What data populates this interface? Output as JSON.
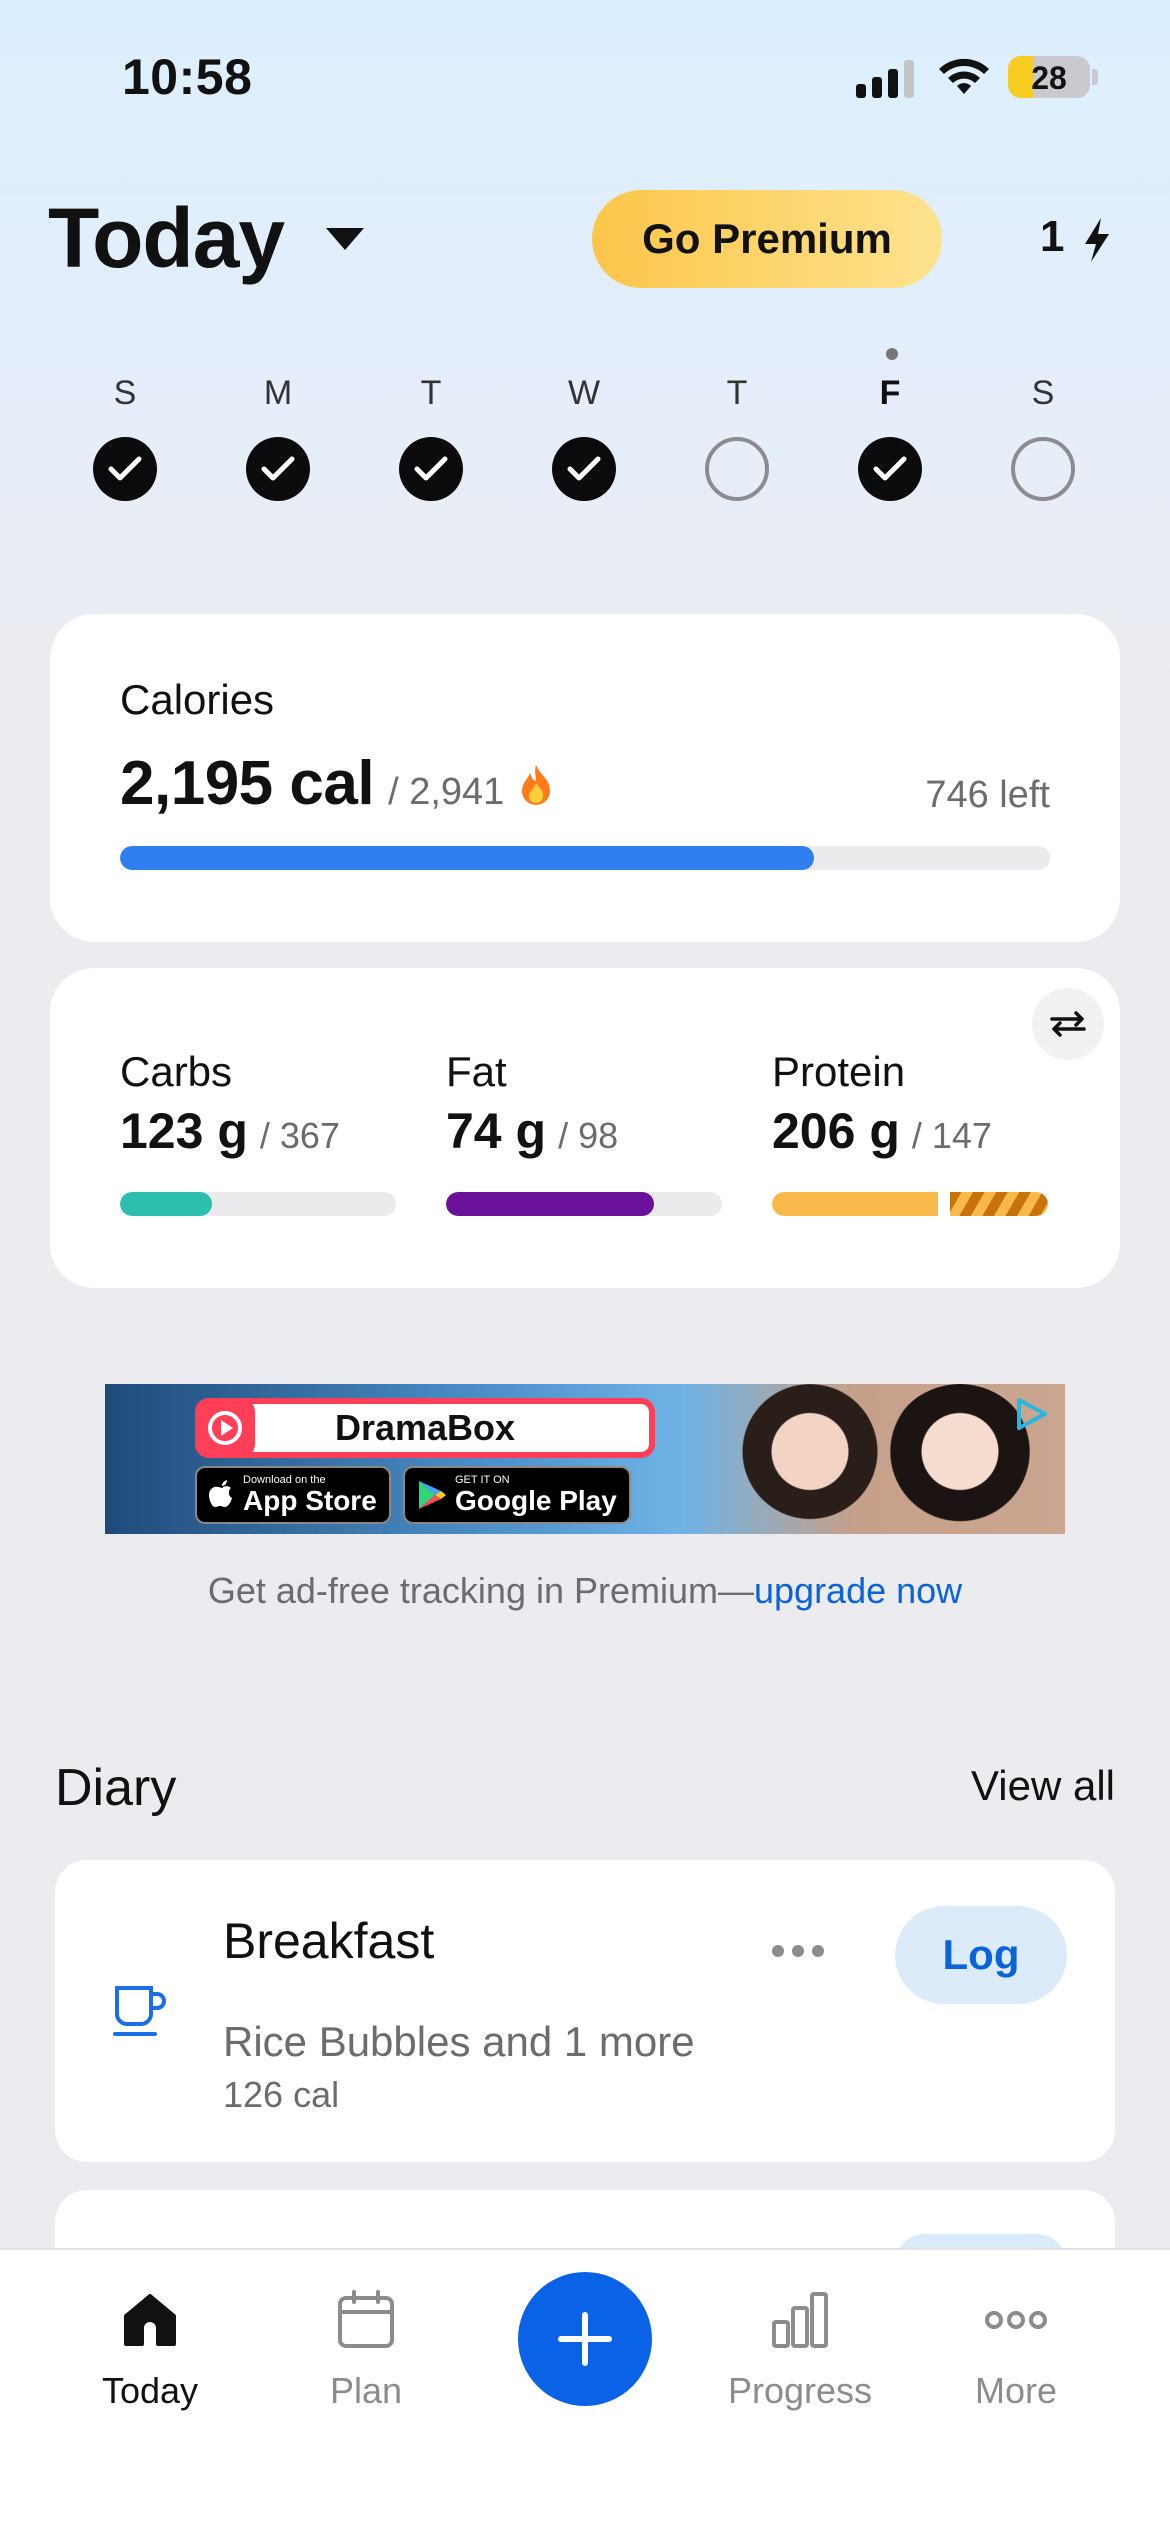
{
  "status": {
    "time": "10:58",
    "battery": "28"
  },
  "header": {
    "title": "Today",
    "premium_label": "Go Premium",
    "streak": "1"
  },
  "week": {
    "days": [
      {
        "letter": "S",
        "done": true
      },
      {
        "letter": "M",
        "done": true
      },
      {
        "letter": "T",
        "done": true
      },
      {
        "letter": "W",
        "done": true
      },
      {
        "letter": "T",
        "done": false
      },
      {
        "letter": "F",
        "done": true,
        "today": true
      },
      {
        "letter": "S",
        "done": false
      }
    ]
  },
  "calories": {
    "label": "Calories",
    "value": "2,195 cal",
    "goal": "/ 2,941",
    "left": "746 left",
    "progress": 0.746,
    "color": "#2f7ff0"
  },
  "macros": [
    {
      "name": "Carbs",
      "value": "123 g",
      "goal": "/ 367",
      "progress": 0.335,
      "color": "#2dbfad"
    },
    {
      "name": "Fat",
      "value": "74 g",
      "goal": "/ 98",
      "progress": 0.755,
      "color": "#6a139a"
    },
    {
      "name": "Protein",
      "value": "206 g",
      "goal": "/ 147",
      "progress": 1.0,
      "over": true,
      "color": "#f9b84a"
    }
  ],
  "ad": {
    "brand": "DramaBox",
    "app_store_small": "Download on the",
    "app_store_big": "App Store",
    "google_small": "GET IT ON",
    "google_big": "Google Play"
  },
  "promo": {
    "text": "Get ad-free tracking in Premium—",
    "link": "upgrade now"
  },
  "diary": {
    "title": "Diary",
    "view_all": "View all",
    "meals": [
      {
        "name": "Breakfast",
        "items": "Rice Bubbles and 1 more",
        "calories": "126 cal",
        "log_label": "Log",
        "icon": "cup-icon"
      }
    ]
  },
  "tabs": [
    {
      "label": "Today",
      "icon": "home-icon",
      "active": true
    },
    {
      "label": "Plan",
      "icon": "calendar-icon",
      "active": false
    },
    {
      "label": "Progress",
      "icon": "bar-chart-icon",
      "active": false
    },
    {
      "label": "More",
      "icon": "more-icon",
      "active": false
    }
  ],
  "accent": "#0a63e6"
}
